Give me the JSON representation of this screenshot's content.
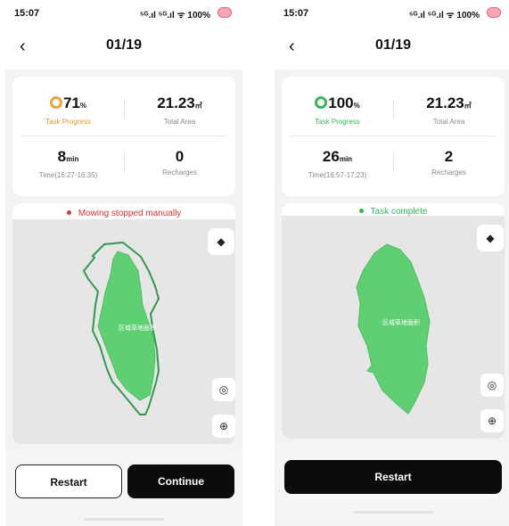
{
  "left": {
    "status": {
      "time": "15:07",
      "signal": "⁵ᴳ.ıl ⁵ᴳ.ıl ᯤ 100%"
    },
    "nav": {
      "title": "01/19"
    },
    "stats": {
      "progress_value": "71",
      "progress_unit": "%",
      "progress_label": "Task Progress",
      "area_value": "21.23",
      "area_unit": "㎡",
      "area_label": "Total Area",
      "time_value": "8",
      "time_unit": "min",
      "time_label": "Time(16:27-16:35)",
      "recharge_value": "0",
      "recharge_label": "Recharges"
    },
    "map": {
      "status_text": "Mowing stopped manually",
      "status_color": "#d9323a",
      "zone_label": "区域草地面积"
    },
    "buttons": {
      "restart": "Restart",
      "continue": "Continue"
    }
  },
  "right": {
    "status": {
      "time": "15:07",
      "signal": "⁵ᴳ.ıl ⁵ᴳ.ıl ᯤ 100%"
    },
    "nav": {
      "title": "01/19"
    },
    "stats": {
      "progress_value": "100",
      "progress_unit": "%",
      "progress_label": "Task Progress",
      "area_value": "21.23",
      "area_unit": "㎡",
      "area_label": "Total Area",
      "time_value": "26",
      "time_unit": "min",
      "time_label": "Time(16:57-17:23)",
      "recharge_value": "2",
      "recharge_label": "Recharges"
    },
    "map": {
      "status_text": "Task complete",
      "status_color": "#35b55a",
      "zone_label": "区域草地面积"
    },
    "buttons": {
      "restart": "Restart"
    }
  },
  "icons": {
    "back": "chevron-left-icon",
    "layers": "layers-icon",
    "locate": "locate-icon",
    "zoom": "zoom-in-icon"
  },
  "colors": {
    "lawn": "#5fcf73",
    "lawn_border": "#2f9a4d",
    "accent_orange": "#f0a23d",
    "accent_green": "#35b55a"
  }
}
